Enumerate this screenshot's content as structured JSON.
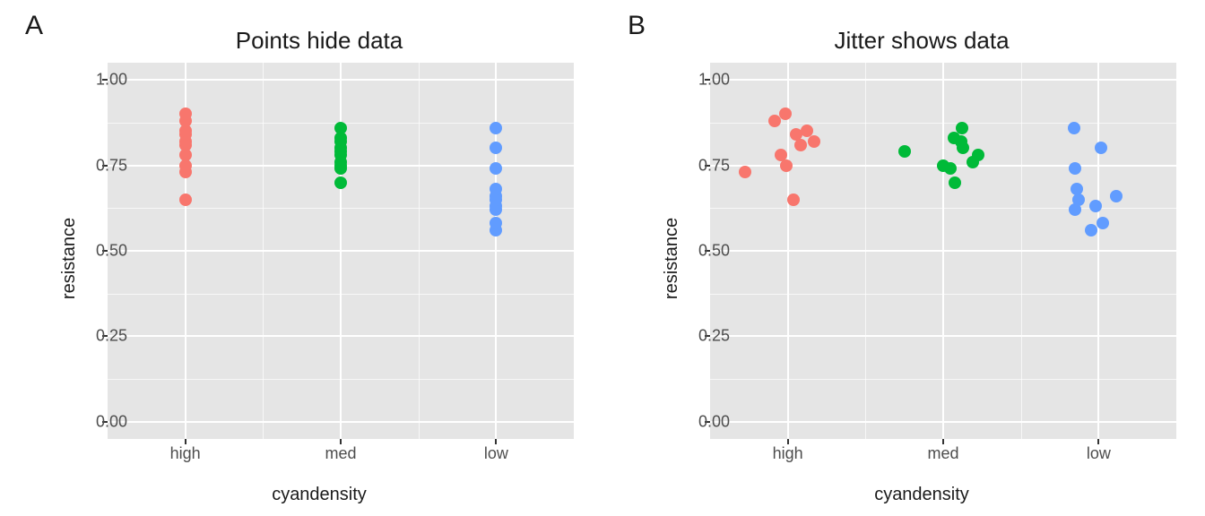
{
  "chart_data": [
    {
      "type": "scatter",
      "panel_letter": "A",
      "title": "Points hide data",
      "xlabel": "cyandensity",
      "ylabel": "resistance",
      "ylim": [
        -0.05,
        1.05
      ],
      "yticks": [
        0.0,
        0.25,
        0.5,
        0.75,
        1.0
      ],
      "categories": [
        "high",
        "med",
        "low"
      ],
      "colors": {
        "high": "#f8766d",
        "med": "#00ba38",
        "low": "#619cff"
      },
      "jitter": false,
      "series": [
        {
          "name": "high",
          "values": [
            0.65,
            0.73,
            0.75,
            0.78,
            0.81,
            0.82,
            0.84,
            0.85,
            0.88,
            0.9
          ]
        },
        {
          "name": "med",
          "values": [
            0.7,
            0.74,
            0.75,
            0.76,
            0.78,
            0.79,
            0.8,
            0.82,
            0.83,
            0.86
          ]
        },
        {
          "name": "low",
          "values": [
            0.56,
            0.58,
            0.62,
            0.63,
            0.65,
            0.66,
            0.68,
            0.74,
            0.8,
            0.86
          ]
        }
      ]
    },
    {
      "type": "scatter",
      "panel_letter": "B",
      "title": "Jitter shows data",
      "xlabel": "cyandensity",
      "ylabel": "resistance",
      "ylim": [
        -0.05,
        1.05
      ],
      "yticks": [
        0.0,
        0.25,
        0.5,
        0.75,
        1.0
      ],
      "categories": [
        "high",
        "med",
        "low"
      ],
      "colors": {
        "high": "#f8766d",
        "med": "#00ba38",
        "low": "#619cff"
      },
      "jitter": true,
      "series": [
        {
          "name": "high",
          "values": [
            0.65,
            0.73,
            0.75,
            0.78,
            0.81,
            0.82,
            0.84,
            0.85,
            0.88,
            0.9
          ]
        },
        {
          "name": "med",
          "values": [
            0.7,
            0.74,
            0.75,
            0.76,
            0.78,
            0.79,
            0.8,
            0.82,
            0.83,
            0.86
          ]
        },
        {
          "name": "low",
          "values": [
            0.56,
            0.58,
            0.62,
            0.63,
            0.65,
            0.66,
            0.68,
            0.74,
            0.8,
            0.86
          ]
        }
      ]
    }
  ]
}
